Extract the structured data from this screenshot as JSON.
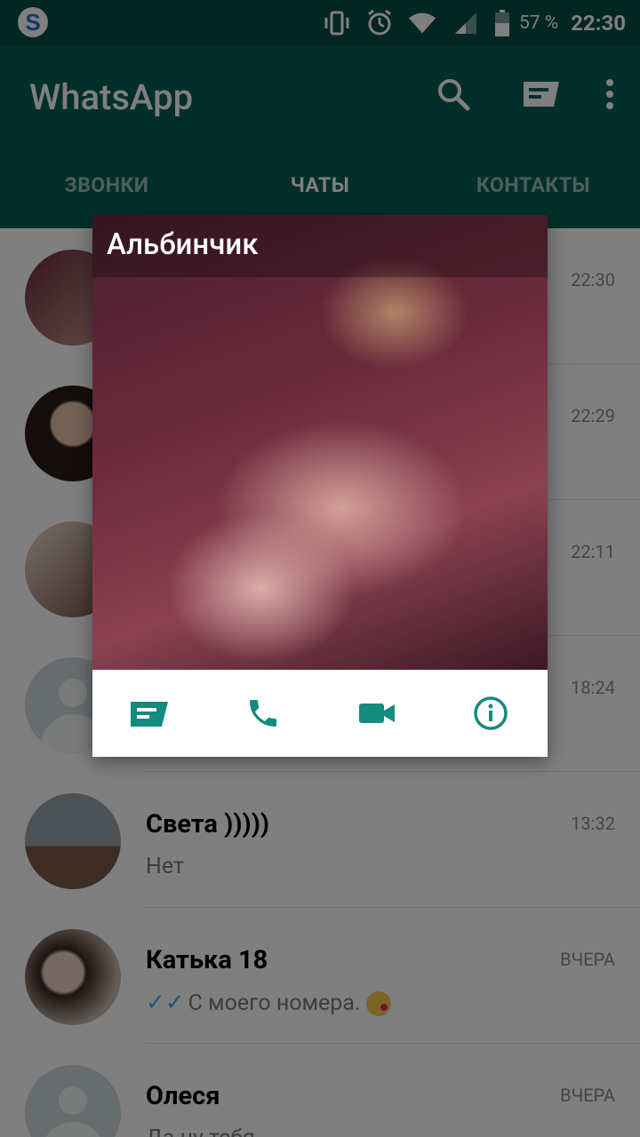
{
  "status_bar": {
    "app_icon": "s-icon",
    "icons": [
      "vibrate-icon",
      "alarm-icon",
      "wifi-icon",
      "signal-icon",
      "battery-icon"
    ],
    "battery_percent": "57 %",
    "time": "22:30"
  },
  "app_bar": {
    "title": "WhatsApp",
    "actions": [
      "search-icon",
      "new-chat-icon",
      "more-icon"
    ]
  },
  "tabs": [
    {
      "label": "ЗВОНКИ",
      "active": false
    },
    {
      "label": "ЧАТЫ",
      "active": true
    },
    {
      "label": "КОНТАКТЫ",
      "active": false
    }
  ],
  "chats": [
    {
      "name": "",
      "time": "22:30",
      "message": ""
    },
    {
      "name": "",
      "time": "22:29",
      "message": ""
    },
    {
      "name": "",
      "time": "22:11",
      "message": ""
    },
    {
      "name": "",
      "time": "18:24",
      "message": ""
    },
    {
      "name": "Света )))))",
      "time": "13:32",
      "message": "Нет"
    },
    {
      "name": "Катька 18",
      "time": "ВЧЕРА",
      "message": "С моего номера.",
      "read_ticks": "✓✓",
      "emoji": "kiss-emoji"
    },
    {
      "name": "Олеся",
      "time": "ВЧЕРА",
      "message": "Да ну тебя"
    }
  ],
  "popup": {
    "contact_name": "Альбинчик",
    "actions": [
      "message-icon",
      "call-icon",
      "video-call-icon",
      "info-icon"
    ]
  },
  "colors": {
    "header": "#075e54",
    "status_bar": "#054d44",
    "accent": "#128c7e",
    "ticks": "#34b7f1"
  }
}
